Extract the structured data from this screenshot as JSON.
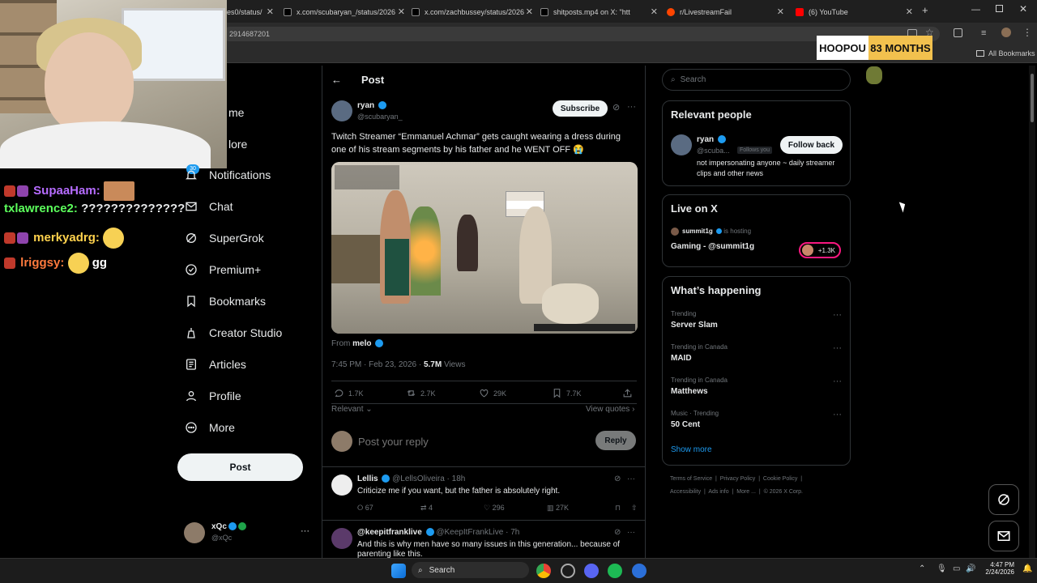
{
  "browser": {
    "tabs": [
      {
        "label": "es0/status/",
        "color": "#2c2c2c"
      },
      {
        "label": "x.com/scubaryan_/status/2026",
        "color": "#000000"
      },
      {
        "label": "x.com/zachbussey/status/2026",
        "color": "#000000"
      },
      {
        "label": "shitposts.mp4 on X: \"htt",
        "color": "#000000"
      },
      {
        "label": "r/LivestreamFail",
        "color": "#ff4500"
      },
      {
        "label": "(6) YouTube",
        "color": "#ff0000"
      }
    ],
    "url": "2914687201",
    "bookmarks_label": "All Bookmarks"
  },
  "chat": [
    {
      "user": "SupaaHam:",
      "message": "",
      "color": "#b66cff"
    },
    {
      "user": "txlawrence2:",
      "message": "??????????????",
      "color": "#5cff5c"
    },
    {
      "user": "merkyadrg:",
      "message": "",
      "color": "#ffd24d"
    },
    {
      "user": "lriggsy:",
      "message": "gg",
      "color": "#ff7a3d"
    }
  ],
  "sidebar": {
    "partial_home": "me",
    "partial_explore": "lore",
    "notification_count": "30",
    "items": [
      {
        "label": "Notifications",
        "icon": "bell-icon"
      },
      {
        "label": "Chat",
        "icon": "mail-icon"
      },
      {
        "label": "SuperGrok",
        "icon": "grok-icon"
      },
      {
        "label": "Premium+",
        "icon": "verified-icon"
      },
      {
        "label": "Bookmarks",
        "icon": "bookmark-icon"
      },
      {
        "label": "Creator Studio",
        "icon": "creator-icon"
      },
      {
        "label": "Articles",
        "icon": "articles-icon"
      },
      {
        "label": "Profile",
        "icon": "person-icon"
      },
      {
        "label": "More",
        "icon": "more-circle-icon"
      }
    ],
    "post_button": "Post",
    "account": {
      "name": "xQc",
      "handle": "@xQc"
    }
  },
  "post": {
    "header": "Post",
    "author_name": "ryan",
    "author_handle": "@scubaryan_",
    "subscribe": "Subscribe",
    "text": "Twitch Streamer “Emmanuel Achmar” gets caught wearing a dress during one of his stream segments by his father and he WENT OFF 😭",
    "from_label": "From",
    "from_user": "melo",
    "timestamp": "7:45 PM · Feb 23, 2026 · ",
    "views_count": "5.7M",
    "views_label": "Views",
    "replies": "1.7K",
    "reposts": "2.7K",
    "likes": "29K",
    "bookmarks": "7.7K",
    "sort_label": "Relevant",
    "view_quotes": "View quotes",
    "reply_placeholder": "Post your reply",
    "reply_button": "Reply"
  },
  "replies": [
    {
      "name": "Lellis",
      "handle": "@LellsOliveira · 18h",
      "text": "Criticize me if you want, but the father is absolutely right.",
      "replies": "67",
      "reposts": "4",
      "likes": "296",
      "views": "27K"
    },
    {
      "name": "@keepitfranklive",
      "handle": "@KeepItFrankLive · 7h",
      "text": "And this is why men have so many issues in this generation... because of parenting like this."
    }
  ],
  "right": {
    "search_placeholder": "Search",
    "relevant_title": "Relevant people",
    "person_name": "ryan",
    "person_handle": "@scuba...",
    "follows_you": "Follows you",
    "follow_back": "Follow back",
    "person_bio": "not impersonating anyone ~ daily streamer clips and other news",
    "live_title": "Live on X",
    "live_host": "summit1g",
    "live_hosting": "is hosting",
    "live_stream": "Gaming - @summit1g",
    "live_count": "+1.3K",
    "happening_title": "What’s happening",
    "trends": [
      {
        "context": "Trending",
        "topic": "Server Slam"
      },
      {
        "context": "Trending in Canada",
        "topic": "MAID"
      },
      {
        "context": "Trending in Canada",
        "topic": "Matthews"
      },
      {
        "context": "Music · Trending",
        "topic": "50 Cent"
      }
    ],
    "show_more": "Show more",
    "footer_line1": [
      "Terms of Service",
      "Privacy Policy",
      "Cookie Policy"
    ],
    "footer_line2": [
      "Accessibility",
      "Ads info",
      "More ...",
      "© 2026 X Corp."
    ]
  },
  "overlay": {
    "name": "HOOPOU",
    "months": "83 MONTHS"
  },
  "taskbar": {
    "search": "Search",
    "time": "4:47 PM",
    "date": "2/24/2026"
  }
}
